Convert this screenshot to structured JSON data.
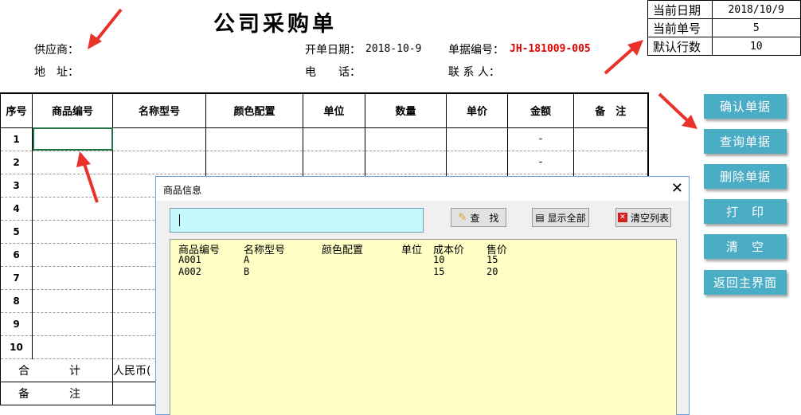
{
  "title": "公司采购单",
  "header": {
    "supplier_label": "供应商：",
    "address_label": "地　址：",
    "open_date_label": "开单日期：",
    "open_date_value": "2018-10-9",
    "doc_no_label": "单据编号：",
    "doc_no_value": "JH-181009-005",
    "phone_label": "电　　话：",
    "contact_label": "联 系 人："
  },
  "info_box": [
    {
      "key": "当前日期",
      "value": "2018/10/9"
    },
    {
      "key": "当前单号",
      "value": "5"
    },
    {
      "key": "默认行数",
      "value": "10"
    }
  ],
  "table": {
    "columns": [
      "序号",
      "商品编号",
      "名称型号",
      "颜色配置",
      "单位",
      "数量",
      "单价",
      "金额",
      "备　注"
    ],
    "row_numbers": [
      "1",
      "2",
      "3",
      "4",
      "5",
      "6",
      "7",
      "8",
      "9",
      "10"
    ],
    "amount_values": [
      "-",
      "-"
    ],
    "total_label": "合　计",
    "total_currency": "人民币(",
    "remark_label": "备　注"
  },
  "side_buttons": [
    "确认单据",
    "查询单据",
    "删除单据",
    "打　印",
    "清　空",
    "返回主界面"
  ],
  "dialog": {
    "title": "商品信息",
    "search_value": "",
    "find_label": "查　找",
    "show_all_label": "显示全部",
    "clear_label": "清空列表",
    "list_headers": [
      "商品编号",
      "名称型号",
      "颜色配置",
      "单位",
      "成本价",
      "售价"
    ],
    "list_rows": [
      [
        "A001",
        "A",
        "",
        "",
        "10",
        "15"
      ],
      [
        "A002",
        "B",
        "",
        "",
        "15",
        "20"
      ]
    ]
  },
  "colors": {
    "button": "#4bacc6",
    "arrow": "#e8322a",
    "doc_no": "#e00000",
    "search_field": "#c6f9fb",
    "list_bg": "#ffffc6"
  }
}
